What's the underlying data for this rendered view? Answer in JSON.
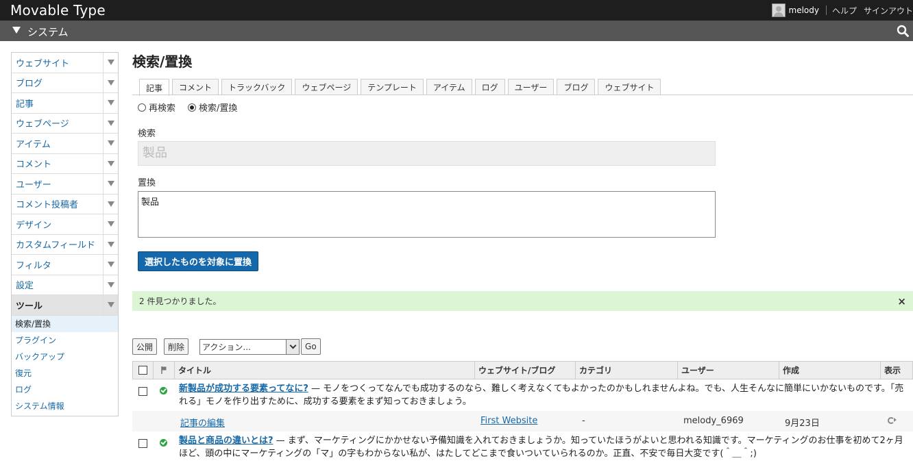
{
  "header": {
    "logo": "Movable Type",
    "user_name": "melody",
    "help": "ヘルプ",
    "signout": "サインアウト"
  },
  "context": {
    "title": "システム"
  },
  "sidebar": {
    "items": [
      {
        "label": "ウェブサイト"
      },
      {
        "label": "ブログ"
      },
      {
        "label": "記事"
      },
      {
        "label": "ウェブページ"
      },
      {
        "label": "アイテム"
      },
      {
        "label": "コメント"
      },
      {
        "label": "ユーザー"
      },
      {
        "label": "コメント投稿者"
      },
      {
        "label": "デザイン"
      },
      {
        "label": "カスタムフィールド"
      },
      {
        "label": "フィルタ"
      },
      {
        "label": "設定"
      },
      {
        "label": "ツール"
      }
    ],
    "tools_submenu": [
      {
        "label": "検索/置換"
      },
      {
        "label": "プラグイン"
      },
      {
        "label": "バックアップ"
      },
      {
        "label": "復元"
      },
      {
        "label": "ログ"
      },
      {
        "label": "システム情報"
      }
    ]
  },
  "main": {
    "title": "検索/置換",
    "tabs": [
      {
        "label": "記事"
      },
      {
        "label": "コメント"
      },
      {
        "label": "トラックバック"
      },
      {
        "label": "ウェブページ"
      },
      {
        "label": "テンプレート"
      },
      {
        "label": "アイテム"
      },
      {
        "label": "ログ"
      },
      {
        "label": "ユーザー"
      },
      {
        "label": "ブログ"
      },
      {
        "label": "ウェブサイト"
      }
    ],
    "mode_research": "再検索",
    "mode_replace": "検索/置換",
    "search_label": "検索",
    "search_value": "製品",
    "replace_label": "置換",
    "replace_value": "製品",
    "replace_button": "選択したものを対象に置換",
    "message": "2 件見つかりました。",
    "message_close": "×",
    "actions": {
      "publish": "公開",
      "delete": "削除",
      "action_select": "アクション...",
      "go": "Go"
    },
    "table": {
      "headers": {
        "title": "タイトル",
        "website_blog": "ウェブサイト/ブログ",
        "category": "カテゴリ",
        "user": "ユーザー",
        "created": "作成",
        "view": "表示"
      },
      "rows": [
        {
          "title": "新製品が成功する要素ってなに?",
          "excerpt": " — モノをつくってなんでも成功するのなら、難しく考えなくてもよかったのかもしれませんよね。でも、人生そんなに簡単にいかないものです。「売れる」モノを作り出すために、成功する要素をまず知っておきましょう。",
          "edit": "記事の編集",
          "website": "First Website",
          "category": "-",
          "user": "melody_6969",
          "date": "9月23日"
        },
        {
          "title": "製品と商品の違いとは?",
          "excerpt": " — まず、マーケティングにかかせない予備知識を入れておきましょうか。知っていたほうがよいと思われる知識です。マーケティングのお仕事を初めて2ヶ月ほど、頭の中にマーケティングの「マ」の字もわからない私が、はたしてどこまで食いついていられるのか。正直、不安で毎日大変です(＾＿＾;)"
        }
      ]
    }
  },
  "colors": {
    "topbar": "#1e1e1e",
    "contextbar": "#555555",
    "primary_button": "#1568ab",
    "success_message": "#dcf5d4",
    "link": "#1768a6"
  }
}
